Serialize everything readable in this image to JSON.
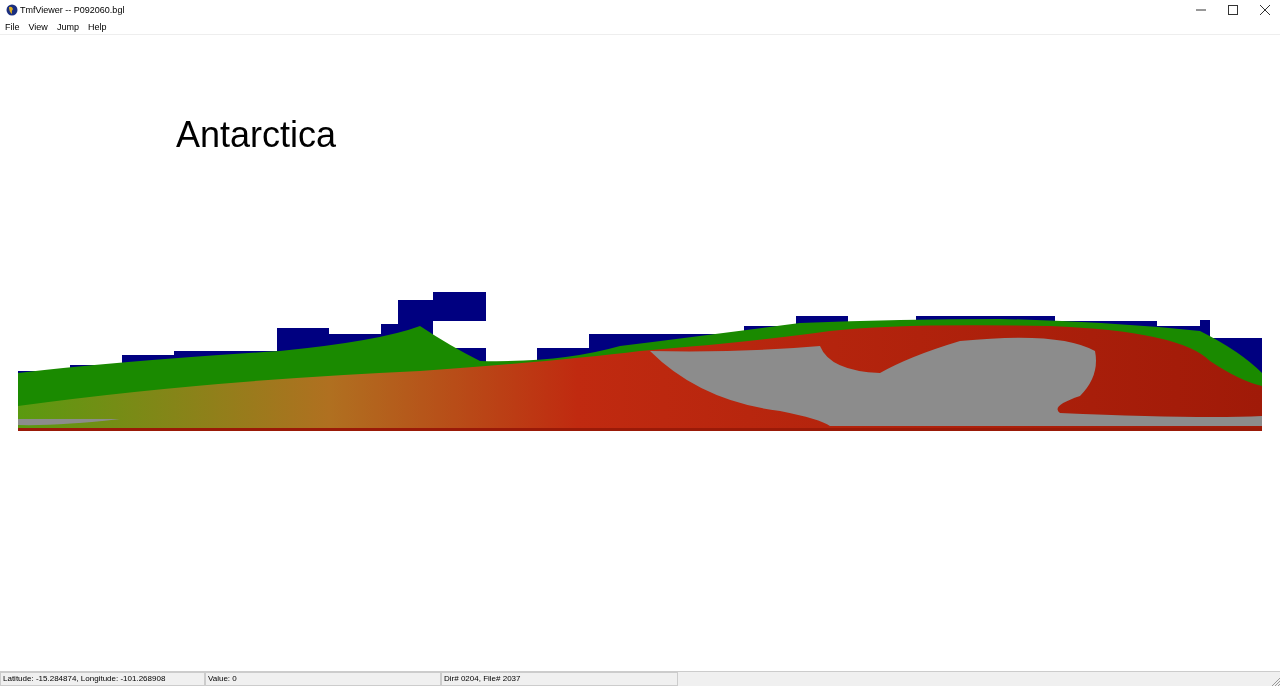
{
  "window": {
    "title": "TmfViewer -- P092060.bgl"
  },
  "menu": [
    "File",
    "View",
    "Jump",
    "Help"
  ],
  "canvas": {
    "label": "Antarctica"
  },
  "status_bar": [
    "Latitude: -15.284874, Longitude: -101.268908",
    "Value: 0",
    "Dir# 0204, File# 2037"
  ]
}
